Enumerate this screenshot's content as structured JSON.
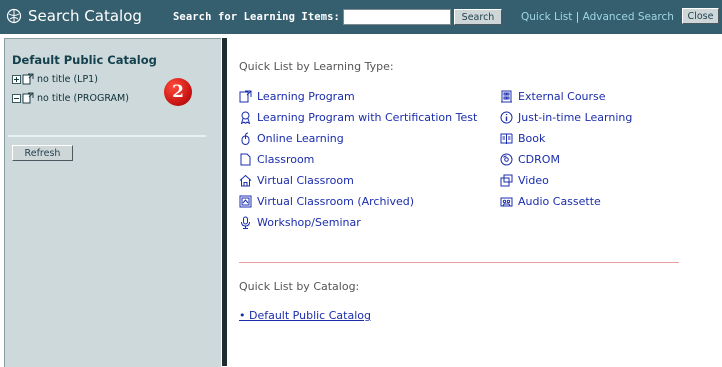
{
  "header": {
    "title": "Search Catalog",
    "search_label": "Search for Learning Items:",
    "search_value": "",
    "search_button": "Search",
    "quick_list_link": "Quick List",
    "separator": "|",
    "advanced_search_link": "Advanced Search",
    "close_button": "Close",
    "logo_icon": "globe-hand-icon",
    "bar_color": "#355f6e"
  },
  "sidebar": {
    "catalog_title": "Default Public Catalog",
    "tree": [
      {
        "label": "no title (LP1)",
        "expander": "plus"
      },
      {
        "label": "no title (PROGRAM)",
        "expander": "minus"
      }
    ],
    "badge": "2",
    "refresh_button": "Refresh",
    "background": "#cdd9da"
  },
  "main": {
    "type_title": "Quick List by Learning Type:",
    "left_items": [
      {
        "label": "Learning Program",
        "icon": "document-arrow-icon"
      },
      {
        "label": "Learning Program with Certification Test",
        "icon": "award-ribbon-icon"
      },
      {
        "label": "Online Learning",
        "icon": "mouse-icon"
      },
      {
        "label": "Classroom",
        "icon": "document-icon"
      },
      {
        "label": "Virtual Classroom",
        "icon": "house-icon"
      },
      {
        "label": "Virtual Classroom (Archived)",
        "icon": "archived-screen-icon"
      },
      {
        "label": "Workshop/Seminar",
        "icon": "microphone-icon"
      }
    ],
    "right_items": [
      {
        "label": "External Course",
        "icon": "building-icon"
      },
      {
        "label": "Just-in-time Learning",
        "icon": "info-circle-icon"
      },
      {
        "label": "Book",
        "icon": "book-icon"
      },
      {
        "label": "CDROM",
        "icon": "disc-icon"
      },
      {
        "label": "Video",
        "icon": "video-icon"
      },
      {
        "label": "Audio Cassette",
        "icon": "cassette-icon"
      }
    ],
    "catalog_title": "Quick List by Catalog:",
    "catalog_link": "• Default Public Catalog",
    "link_color": "#1b2dac"
  }
}
